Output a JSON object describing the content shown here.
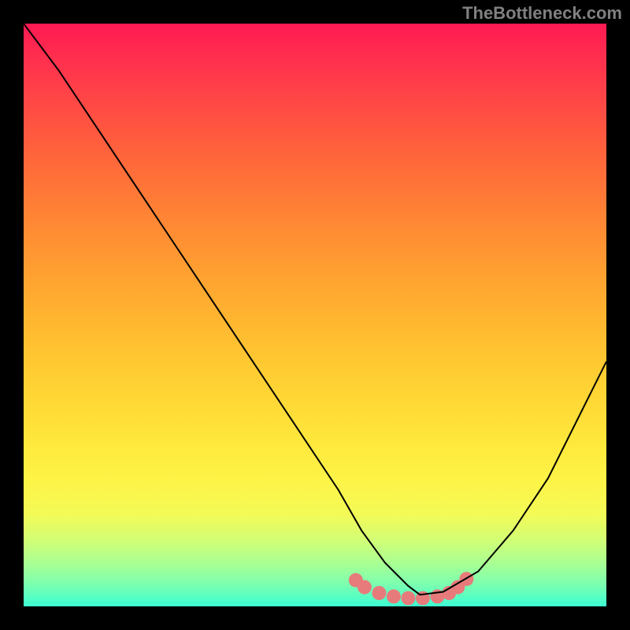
{
  "watermark": "TheBottleneck.com",
  "chart_data": {
    "type": "line",
    "title": "",
    "xlabel": "",
    "ylabel": "",
    "xlim": [
      0,
      100
    ],
    "ylim": [
      0,
      100
    ],
    "background_gradient": {
      "top": "#ff1a52",
      "bottom": "#3cffd2",
      "meaning": "red = high bottleneck, green = low bottleneck"
    },
    "series": [
      {
        "name": "bottleneck-curve",
        "color": "#000000",
        "x": [
          0,
          6,
          12,
          18,
          24,
          30,
          36,
          42,
          48,
          54,
          58,
          62,
          66,
          68,
          72,
          78,
          84,
          90,
          100
        ],
        "values": [
          100,
          92,
          83,
          74,
          65,
          56,
          47,
          38,
          29,
          20,
          13,
          7.5,
          3.5,
          2,
          2.5,
          6,
          13,
          22,
          42
        ]
      }
    ],
    "marker_cluster": {
      "name": "optimal-range",
      "color": "#e77b7b",
      "points": [
        {
          "x": 57,
          "y": 4.5
        },
        {
          "x": 58.5,
          "y": 3.3
        },
        {
          "x": 61,
          "y": 2.3
        },
        {
          "x": 63.5,
          "y": 1.7
        },
        {
          "x": 66,
          "y": 1.4
        },
        {
          "x": 68.5,
          "y": 1.4
        },
        {
          "x": 71,
          "y": 1.7
        },
        {
          "x": 73,
          "y": 2.3
        },
        {
          "x": 74.5,
          "y": 3.3
        },
        {
          "x": 76,
          "y": 4.7
        }
      ],
      "radius_px": 9
    }
  }
}
